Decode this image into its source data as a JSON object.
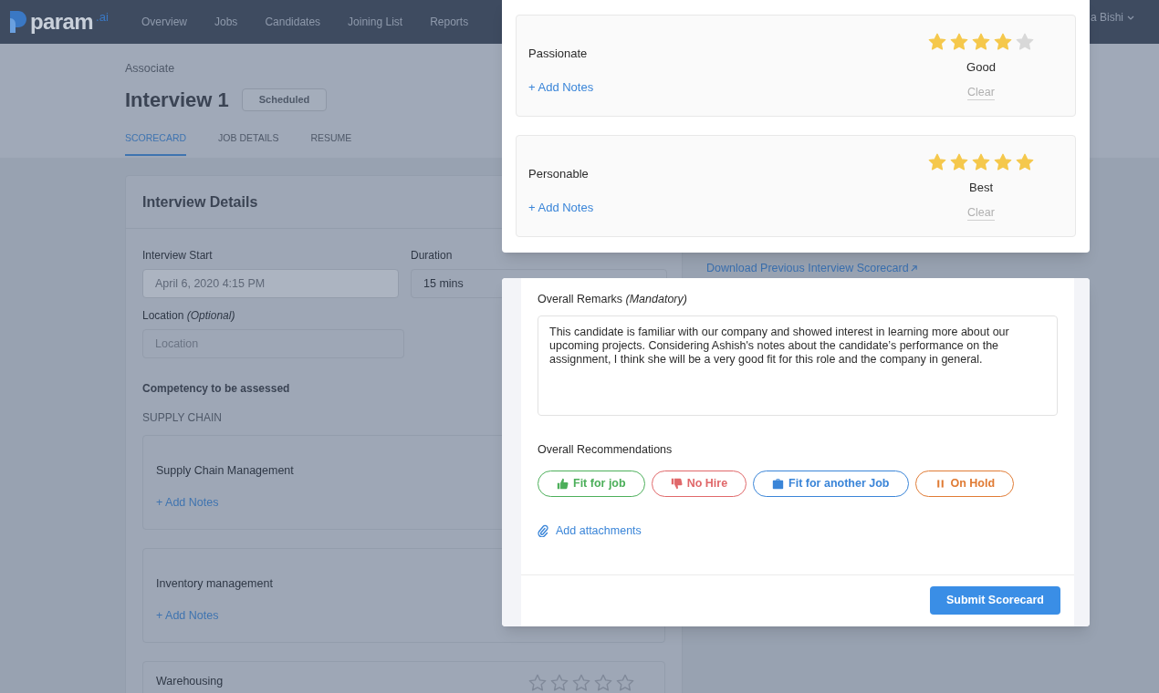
{
  "nav": {
    "logo": {
      "name": "param",
      "suffix": ".ai"
    },
    "items": [
      {
        "label": "Overview",
        "selected": false
      },
      {
        "label": "Jobs",
        "selected": false
      },
      {
        "label": "Candidates",
        "selected": false
      },
      {
        "label": "Joining List",
        "selected": false
      },
      {
        "label": "Reports",
        "selected": false
      }
    ],
    "user": "a Bishi"
  },
  "page": {
    "breadcrumb": "Associate",
    "title": "Interview 1",
    "status": "Scheduled",
    "tabs": [
      {
        "label": "SCORECARD",
        "selected": true
      },
      {
        "label": "JOB DETAILS",
        "selected": false
      },
      {
        "label": "RESUME",
        "selected": false
      }
    ]
  },
  "interview_details": {
    "title": "Interview Details",
    "fields": [
      {
        "label": "Interview Start",
        "value": "April 6, 2020 4:15 PM",
        "disabled": true
      },
      {
        "label": "Duration",
        "value": "15 mins",
        "disabled": false
      },
      {
        "label": "Location *(Optional)*",
        "placeholder": "Location",
        "disabled": false
      }
    ],
    "competency_heading": "Competency to be assessed",
    "group": "SUPPLY CHAIN",
    "competencies": [
      {
        "name": "Supply Chain Management",
        "add_notes": "+ Add Notes"
      },
      {
        "name": "Inventory management",
        "add_notes": "+ Add Notes"
      },
      {
        "name": "Warehousing",
        "stars": 0
      }
    ]
  },
  "download_link": "Download Previous Interview Scorecard",
  "ratings_panel": {
    "items": [
      {
        "name": "Passionate",
        "add_notes": "+ Add Notes",
        "stars": 4,
        "rating_label": "Good",
        "clear": "Clear"
      },
      {
        "name": "Personable",
        "add_notes": "+ Add Notes",
        "stars": 5,
        "rating_label": "Best",
        "clear": "Clear"
      }
    ]
  },
  "remarks_panel": {
    "remarks_label": "Overall Remarks *(Mandatory)*",
    "remarks": "This candidate is familiar with our company and showed interest in learning more about our upcoming projects. Considering Ashish's notes about the candidate’s performance on the assignment, I think she will be a very good fit for this role and the company in general.",
    "recommendations_label": "Overall Recommendations",
    "recommendations": [
      {
        "label": "Fit for job",
        "kind": "fit",
        "color": "#4caf5a",
        "selected": false
      },
      {
        "label": "No Hire",
        "kind": "no_hire",
        "color": "#e0686a",
        "selected": false
      },
      {
        "label": "Fit for another Job",
        "kind": "other_job",
        "color": "#3a85d8",
        "selected": false
      },
      {
        "label": "On Hold",
        "kind": "hold",
        "color": "#e07b34",
        "selected": false
      }
    ],
    "attachments": "Add attachments",
    "submit": "Submit Scorecard"
  }
}
